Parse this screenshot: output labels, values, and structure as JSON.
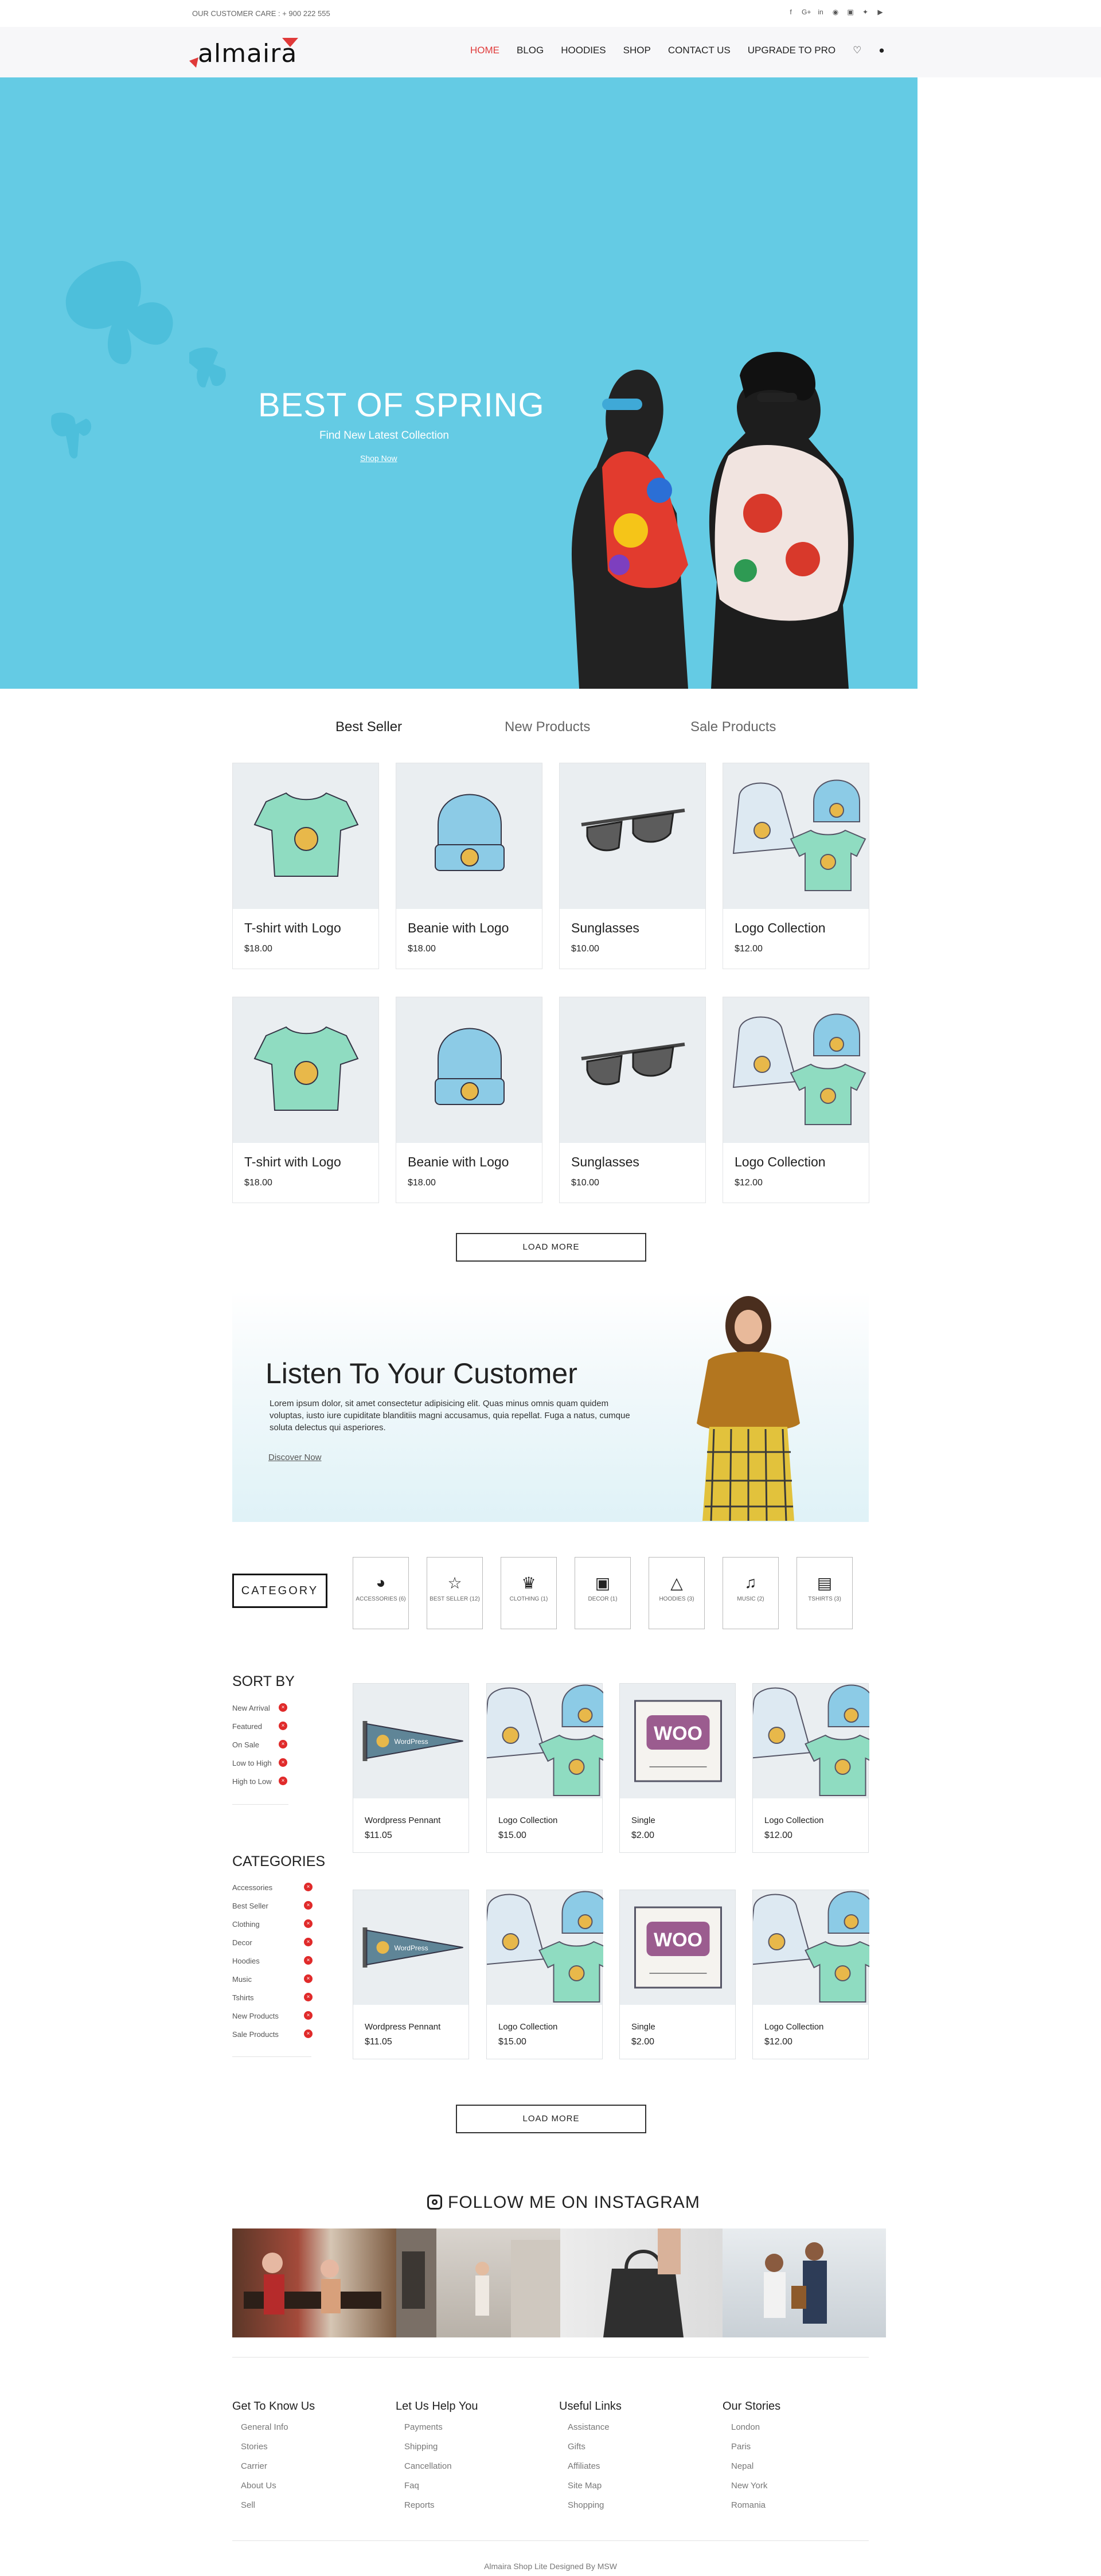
{
  "topbar": {
    "customer_care": "OUR CUSTOMER CARE : + 900 222 555",
    "social_icons": [
      "facebook-icon",
      "google-plus-icon",
      "linkedin-icon",
      "pinterest-icon",
      "instagram-icon",
      "twitter-icon",
      "youtube-icon"
    ]
  },
  "brand": {
    "logo_text": "almaira",
    "accent": "#e03a3a"
  },
  "nav": {
    "items": [
      "HOME",
      "BLOG",
      "HOODIES",
      "SHOP",
      "CONTACT US",
      "UPGRADE TO PRO"
    ],
    "active": "HOME",
    "icons": [
      "heart-icon",
      "user-icon"
    ]
  },
  "hero": {
    "title": "BEST OF SPRING",
    "subtitle": "Find New Latest Collection",
    "link": "Shop Now",
    "bg_color": "#64cbe4"
  },
  "product_tabs": [
    "Best Seller",
    "New Products",
    "Sale Products"
  ],
  "products": [
    {
      "name": "T-shirt with Logo",
      "price": "$18.00",
      "image": "tshirt"
    },
    {
      "name": "Beanie with Logo",
      "price": "$18.00",
      "image": "beanie"
    },
    {
      "name": "Sunglasses",
      "price": "$10.00",
      "image": "sunglasses"
    },
    {
      "name": "Logo Collection",
      "price": "$12.00",
      "image": "collection"
    },
    {
      "name": "T-shirt with Logo",
      "price": "$18.00",
      "image": "tshirt"
    },
    {
      "name": "Beanie with Logo",
      "price": "$18.00",
      "image": "beanie"
    },
    {
      "name": "Sunglasses",
      "price": "$10.00",
      "image": "sunglasses"
    },
    {
      "name": "Logo Collection",
      "price": "$12.00",
      "image": "collection"
    }
  ],
  "load_more": "LOAD MORE",
  "promo": {
    "title": "Listen To Your Customer",
    "text": "Lorem ipsum dolor, sit amet consectetur adipisicing elit. Quas minus omnis quam quidem voluptas, iusto iure cupiditate blanditiis magni accusamus, quia repellat. Fuga a natus, cumque soluta delectus qui asperiores.",
    "link": "Discover Now"
  },
  "category": {
    "button": "CATEGORY",
    "items": [
      {
        "label": "ACCESSORIES (6)",
        "icon": "cap-icon"
      },
      {
        "label": "BEST SELLER (12)",
        "icon": "star-icon"
      },
      {
        "label": "CLOTHING (1)",
        "icon": "clothing-icon"
      },
      {
        "label": "DECOR (1)",
        "icon": "camera-icon"
      },
      {
        "label": "HOODIES (3)",
        "icon": "hoodie-icon"
      },
      {
        "label": "MUSIC (2)",
        "icon": "music-icon"
      },
      {
        "label": "TSHIRTS (3)",
        "icon": "tshirt-icon"
      }
    ]
  },
  "sidebar": {
    "sort_title": "SORT BY",
    "sort_items": [
      "New Arrival",
      "Featured",
      "On Sale",
      "Low to High",
      "High to Low"
    ],
    "cat_title": "CATEGORIES",
    "cat_items": [
      "Accessories",
      "Best Seller",
      "Clothing",
      "Decor",
      "Hoodies",
      "Music",
      "Tshirts",
      "New Products",
      "Sale Products"
    ]
  },
  "shop_products": [
    {
      "name": "Wordpress Pennant",
      "price": "$11.05",
      "image": "pennant"
    },
    {
      "name": "Logo Collection",
      "price": "$15.00",
      "image": "collection"
    },
    {
      "name": "Single",
      "price": "$2.00",
      "image": "woo"
    },
    {
      "name": "Logo Collection",
      "price": "$12.00",
      "image": "collection"
    },
    {
      "name": "Wordpress Pennant",
      "price": "$11.05",
      "image": "pennant"
    },
    {
      "name": "Logo Collection",
      "price": "$15.00",
      "image": "collection"
    },
    {
      "name": "Single",
      "price": "$2.00",
      "image": "woo"
    },
    {
      "name": "Logo Collection",
      "price": "$12.00",
      "image": "collection"
    }
  ],
  "instagram": {
    "title": "FOLLOW ME ON INSTAGRAM"
  },
  "footer": {
    "columns": [
      {
        "title": "Get To Know Us",
        "links": [
          "General Info",
          "Stories",
          "Carrier",
          "About Us",
          "Sell"
        ]
      },
      {
        "title": "Let Us Help You",
        "links": [
          "Payments",
          "Shipping",
          "Cancellation",
          "Faq",
          "Reports"
        ]
      },
      {
        "title": "Useful Links",
        "links": [
          "Assistance",
          "Gifts",
          "Affiliates",
          "Site Map",
          "Shopping"
        ]
      },
      {
        "title": "Our Stories",
        "links": [
          "London",
          "Paris",
          "Nepal",
          "New York",
          "Romania"
        ]
      }
    ],
    "copyright": "Almaira Shop Lite Designed By MSW"
  }
}
